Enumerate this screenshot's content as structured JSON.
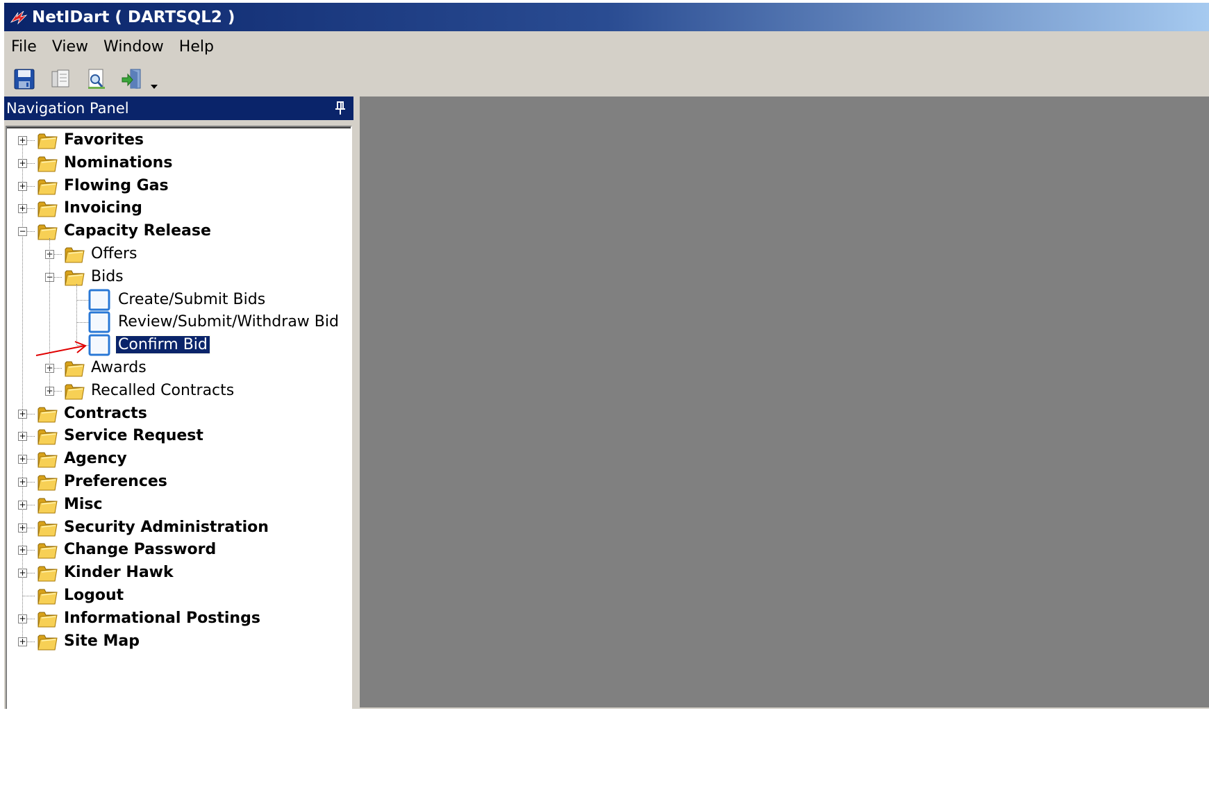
{
  "window": {
    "title": "NetIDart ( DARTSQL2 )",
    "app_icon": "netidart-logo-icon"
  },
  "menu": [
    {
      "label": "File"
    },
    {
      "label": "View"
    },
    {
      "label": "Window"
    },
    {
      "label": "Help"
    }
  ],
  "toolbar": {
    "buttons": [
      {
        "icon": "save-icon"
      },
      {
        "icon": "copy-icon"
      },
      {
        "icon": "print-preview-icon"
      },
      {
        "icon": "exit-icon"
      }
    ],
    "dropdown_icon": "chevron-down-icon"
  },
  "nav_panel": {
    "title": "Navigation Panel",
    "pin_icon": "pin-icon",
    "tree": [
      {
        "label": "Favorites",
        "level": 0,
        "type": "folder",
        "expander": "+",
        "bold": true
      },
      {
        "label": "Nominations",
        "level": 0,
        "type": "folder",
        "expander": "+",
        "bold": true
      },
      {
        "label": "Flowing Gas",
        "level": 0,
        "type": "folder",
        "expander": "+",
        "bold": true
      },
      {
        "label": "Invoicing",
        "level": 0,
        "type": "folder",
        "expander": "+",
        "bold": true
      },
      {
        "label": "Capacity Release",
        "level": 0,
        "type": "folder",
        "expander": "-",
        "bold": true
      },
      {
        "label": "Offers",
        "level": 1,
        "type": "folder",
        "expander": "+",
        "bold": false
      },
      {
        "label": "Bids",
        "level": 1,
        "type": "folder",
        "expander": "-",
        "bold": false
      },
      {
        "label": "Create/Submit Bids",
        "level": 2,
        "type": "page",
        "expander": "",
        "bold": false
      },
      {
        "label": "Review/Submit/Withdraw Bid",
        "level": 2,
        "type": "page",
        "expander": "",
        "bold": false
      },
      {
        "label": "Confirm Bid",
        "level": 2,
        "type": "page",
        "expander": "",
        "bold": false,
        "selected": true
      },
      {
        "label": "Awards",
        "level": 1,
        "type": "folder",
        "expander": "+",
        "bold": false
      },
      {
        "label": "Recalled Contracts",
        "level": 1,
        "type": "folder",
        "expander": "+",
        "bold": false
      },
      {
        "label": "Contracts",
        "level": 0,
        "type": "folder",
        "expander": "+",
        "bold": true
      },
      {
        "label": "Service Request",
        "level": 0,
        "type": "folder",
        "expander": "+",
        "bold": true
      },
      {
        "label": "Agency",
        "level": 0,
        "type": "folder",
        "expander": "+",
        "bold": true
      },
      {
        "label": "Preferences",
        "level": 0,
        "type": "folder",
        "expander": "+",
        "bold": true
      },
      {
        "label": "Misc",
        "level": 0,
        "type": "folder",
        "expander": "+",
        "bold": true
      },
      {
        "label": "Security Administration",
        "level": 0,
        "type": "folder",
        "expander": "+",
        "bold": true
      },
      {
        "label": "Change Password",
        "level": 0,
        "type": "folder",
        "expander": "+",
        "bold": true
      },
      {
        "label": "Kinder Hawk",
        "level": 0,
        "type": "folder",
        "expander": "+",
        "bold": true
      },
      {
        "label": "Logout",
        "level": 0,
        "type": "folder",
        "expander": "",
        "bold": true
      },
      {
        "label": "Informational Postings",
        "level": 0,
        "type": "folder",
        "expander": "+",
        "bold": true
      },
      {
        "label": "Site Map",
        "level": 0,
        "type": "folder",
        "expander": "+",
        "bold": true
      }
    ]
  },
  "annotation": {
    "icon": "red-arrow-annotation-icon",
    "color": "#e00000"
  },
  "colors": {
    "titlebar_dark": "#0a246a",
    "titlebar_light": "#a6caf0",
    "chrome": "#d4d0c8",
    "workspace": "#808080",
    "selection": "#0a246a"
  }
}
